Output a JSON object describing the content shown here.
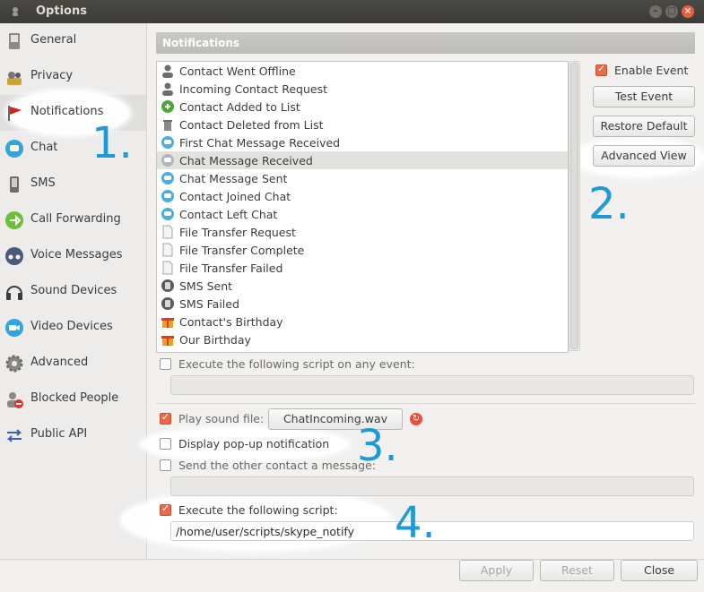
{
  "window": {
    "title": "Options"
  },
  "sidebar": {
    "items": [
      {
        "label": "General",
        "icon": "general-icon"
      },
      {
        "label": "Privacy",
        "icon": "privacy-icon"
      },
      {
        "label": "Notifications",
        "icon": "flag-icon"
      },
      {
        "label": "Chat",
        "icon": "chat-icon"
      },
      {
        "label": "SMS",
        "icon": "phone-icon"
      },
      {
        "label": "Call Forwarding",
        "icon": "call-forwarding-icon"
      },
      {
        "label": "Voice Messages",
        "icon": "voicemail-icon"
      },
      {
        "label": "Sound Devices",
        "icon": "headset-icon"
      },
      {
        "label": "Video Devices",
        "icon": "camera-icon"
      },
      {
        "label": "Advanced",
        "icon": "gear-icon"
      },
      {
        "label": "Blocked People",
        "icon": "blocked-user-icon"
      },
      {
        "label": "Public API",
        "icon": "api-arrows-icon"
      }
    ]
  },
  "panel": {
    "header": "Notifications"
  },
  "events": [
    {
      "label": "Contact Went Offline",
      "icon": "contact-icon"
    },
    {
      "label": "Incoming Contact Request",
      "icon": "contact-icon"
    },
    {
      "label": "Contact Added to List",
      "icon": "contact-add-icon"
    },
    {
      "label": "Contact Deleted from List",
      "icon": "trash-icon"
    },
    {
      "label": "First Chat Message Received",
      "icon": "chat-bubble-icon"
    },
    {
      "label": "Chat Message Received",
      "icon": "chat-bubble-icon",
      "selected": true
    },
    {
      "label": "Chat Message Sent",
      "icon": "chat-bubble-icon"
    },
    {
      "label": "Contact Joined Chat",
      "icon": "chat-bubble-icon"
    },
    {
      "label": "Contact Left Chat",
      "icon": "chat-bubble-icon"
    },
    {
      "label": "File Transfer Request",
      "icon": "file-icon"
    },
    {
      "label": "File Transfer Complete",
      "icon": "file-icon"
    },
    {
      "label": "File Transfer Failed",
      "icon": "file-icon"
    },
    {
      "label": "SMS Sent",
      "icon": "sms-icon"
    },
    {
      "label": "SMS Failed",
      "icon": "sms-icon"
    },
    {
      "label": "Contact's Birthday",
      "icon": "gift-icon"
    },
    {
      "label": "Our Birthday",
      "icon": "gift-icon"
    }
  ],
  "right": {
    "enable_event": "Enable Event",
    "test_event": "Test Event",
    "restore_default": "Restore Default",
    "advanced_view": "Advanced View"
  },
  "options": {
    "any_event_script": "Execute the following script on any event:",
    "play_sound": "Play sound file:",
    "sound_file": "ChatIncoming.wav",
    "display_popup": "Display pop-up notification",
    "send_message": "Send the other contact a message:",
    "execute_script": "Execute the following script:",
    "script_path": "/home/user/scripts/skype_notify"
  },
  "footer": {
    "apply": "Apply",
    "reset": "Reset",
    "close": "Close"
  },
  "callouts": {
    "one": "1.",
    "two": "2.",
    "three": "3.",
    "four": "4."
  },
  "colors": {
    "accent": "#1e9ad6",
    "checkbox_on": "#e86a4a"
  }
}
